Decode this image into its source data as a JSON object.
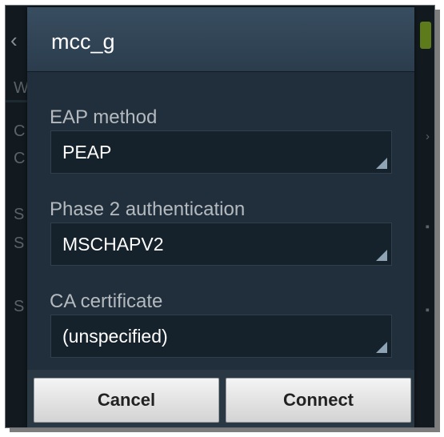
{
  "dialog": {
    "title": "mcc_g",
    "fields": [
      {
        "label": "EAP method",
        "value": "PEAP"
      },
      {
        "label": "Phase 2 authentication",
        "value": "MSCHAPV2"
      },
      {
        "label": "CA certificate",
        "value": "(unspecified)"
      }
    ],
    "buttons": {
      "cancel": "Cancel",
      "connect": "Connect"
    }
  },
  "background": {
    "back_icon": "‹",
    "letters": [
      "W",
      "C",
      "C",
      "S",
      "S",
      "S"
    ]
  },
  "colors": {
    "dialog_bg": "#202f3b",
    "title_bar": "#384d60",
    "select_bg": "#15212b",
    "label_text": "#b4babf"
  }
}
